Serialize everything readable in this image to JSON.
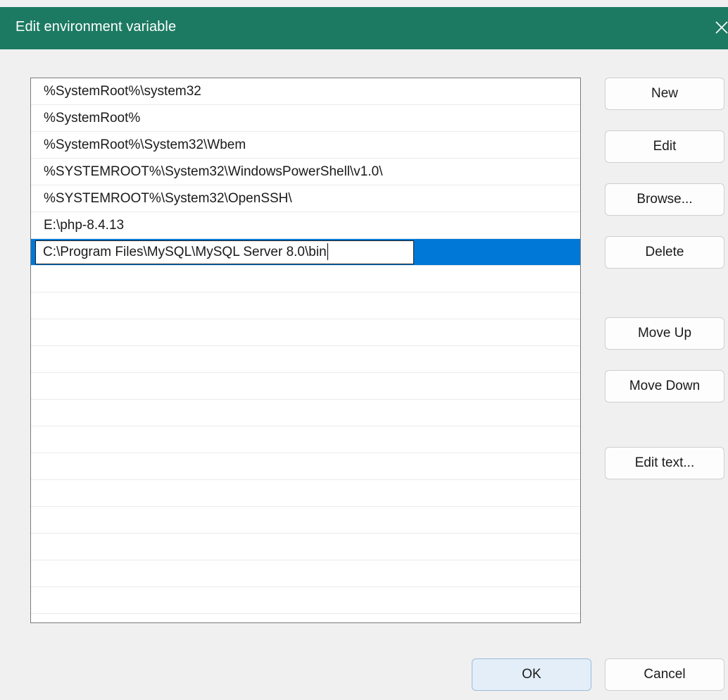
{
  "window": {
    "title": "Edit environment variable",
    "accent_color": "#1c7a62",
    "selection_color": "#0078d7"
  },
  "path_list": {
    "items": [
      "%SystemRoot%\\system32",
      "%SystemRoot%",
      "%SystemRoot%\\System32\\Wbem",
      "%SYSTEMROOT%\\System32\\WindowsPowerShell\\v1.0\\",
      "%SYSTEMROOT%\\System32\\OpenSSH\\",
      "E:\\php-8.4.13"
    ],
    "editing_value": "C:\\Program Files\\MySQL\\MySQL Server 8.0\\bin"
  },
  "buttons": {
    "new": "New",
    "edit": "Edit",
    "browse": "Browse...",
    "delete": "Delete",
    "move_up": "Move Up",
    "move_down": "Move Down",
    "edit_text": "Edit text...",
    "ok": "OK",
    "cancel": "Cancel"
  },
  "icons": {
    "close": "close-icon"
  }
}
